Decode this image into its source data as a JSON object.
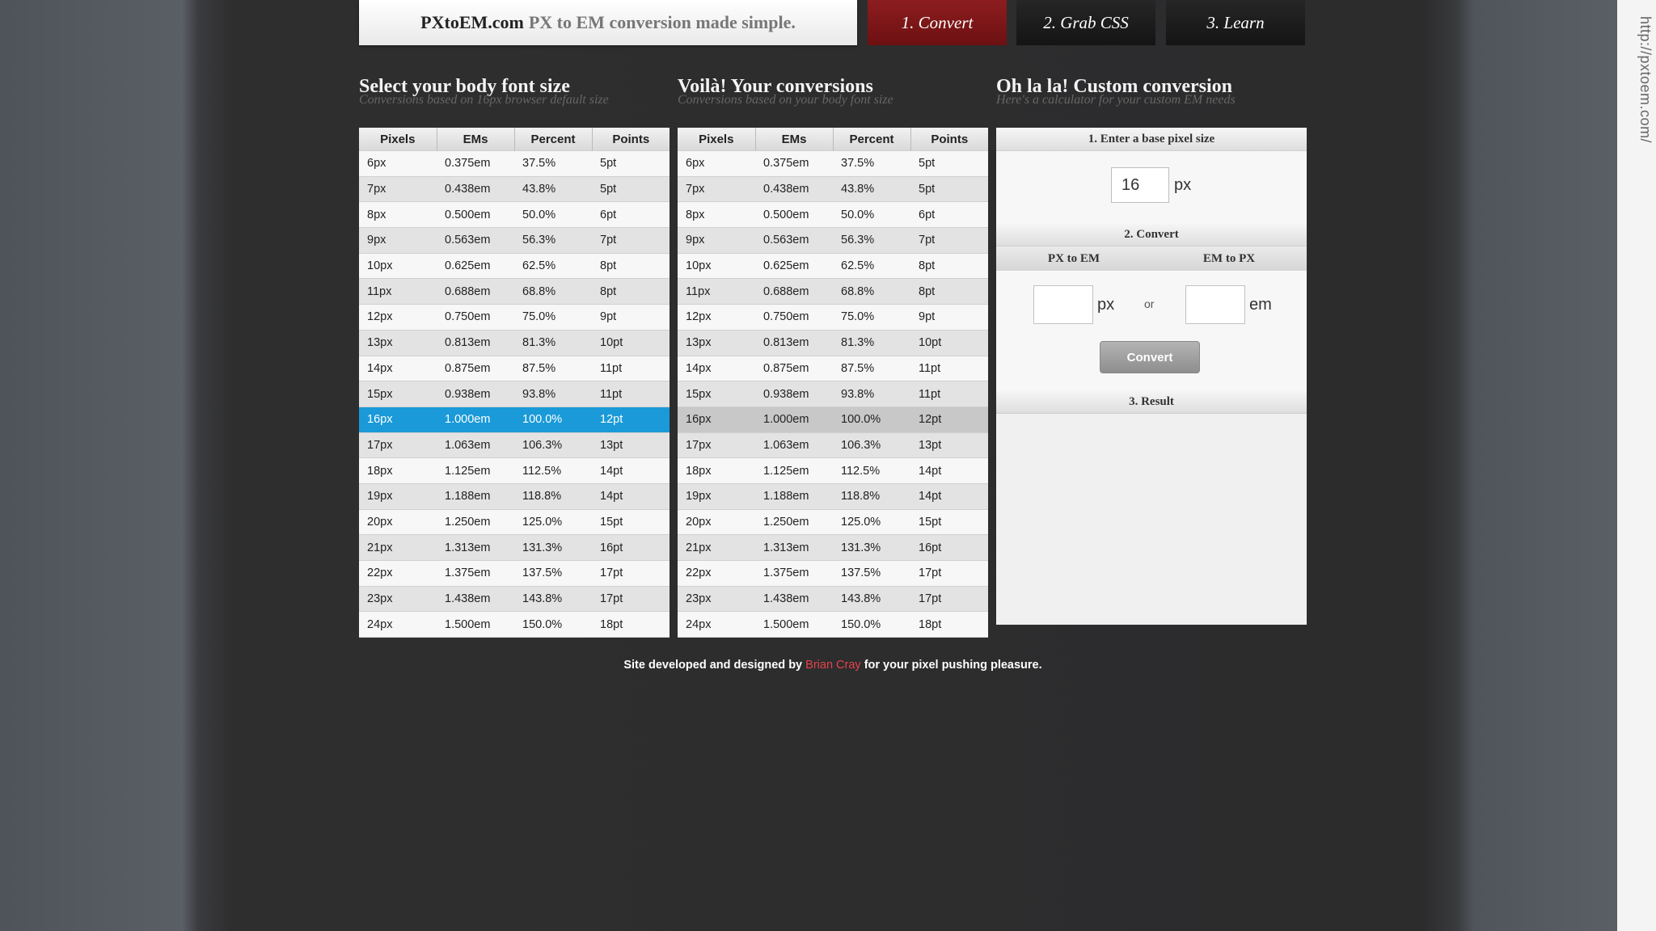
{
  "side_url": "http://pxtoem.com/",
  "header": {
    "site_name": "PXtoEM.com",
    "tagline": "PX to EM conversion made simple.",
    "tabs": [
      "1. Convert",
      "2. Grab CSS",
      "3. Learn"
    ]
  },
  "sections": {
    "body_size": {
      "title": "Select your body font size",
      "subtitle": "Conversions based on 16px browser default size"
    },
    "conversions": {
      "title": "Voilà! Your conversions",
      "subtitle": "Conversions based on your body font size"
    },
    "custom": {
      "title": "Oh la la! Custom conversion",
      "subtitle": "Here's a calculator for your custom EM needs"
    }
  },
  "table": {
    "headers": [
      "Pixels",
      "EMs",
      "Percent",
      "Points"
    ],
    "selected_index": 10,
    "rows": [
      [
        "6px",
        "0.375em",
        "37.5%",
        "5pt"
      ],
      [
        "7px",
        "0.438em",
        "43.8%",
        "5pt"
      ],
      [
        "8px",
        "0.500em",
        "50.0%",
        "6pt"
      ],
      [
        "9px",
        "0.563em",
        "56.3%",
        "7pt"
      ],
      [
        "10px",
        "0.625em",
        "62.5%",
        "8pt"
      ],
      [
        "11px",
        "0.688em",
        "68.8%",
        "8pt"
      ],
      [
        "12px",
        "0.750em",
        "75.0%",
        "9pt"
      ],
      [
        "13px",
        "0.813em",
        "81.3%",
        "10pt"
      ],
      [
        "14px",
        "0.875em",
        "87.5%",
        "11pt"
      ],
      [
        "15px",
        "0.938em",
        "93.8%",
        "11pt"
      ],
      [
        "16px",
        "1.000em",
        "100.0%",
        "12pt"
      ],
      [
        "17px",
        "1.063em",
        "106.3%",
        "13pt"
      ],
      [
        "18px",
        "1.125em",
        "112.5%",
        "14pt"
      ],
      [
        "19px",
        "1.188em",
        "118.8%",
        "14pt"
      ],
      [
        "20px",
        "1.250em",
        "125.0%",
        "15pt"
      ],
      [
        "21px",
        "1.313em",
        "131.3%",
        "16pt"
      ],
      [
        "22px",
        "1.375em",
        "137.5%",
        "17pt"
      ],
      [
        "23px",
        "1.438em",
        "143.8%",
        "17pt"
      ],
      [
        "24px",
        "1.500em",
        "150.0%",
        "18pt"
      ]
    ]
  },
  "custom_panel": {
    "step1": "1. Enter a base pixel size",
    "base_value": "16",
    "base_unit": "px",
    "step2": "2. Convert",
    "px_to_em": "PX to EM",
    "em_to_px": "EM to PX",
    "px_unit": "px",
    "or": "or",
    "em_unit": "em",
    "convert_label": "Convert",
    "step3": "3. Result"
  },
  "footer": {
    "before": "Site developed and designed by",
    "author": "Brian Cray",
    "after": "for your pixel pushing pleasure."
  },
  "colors": {
    "convert_tab": "#7d1618",
    "selected_row": "#1a9ad8",
    "author_link": "#e6434a"
  }
}
